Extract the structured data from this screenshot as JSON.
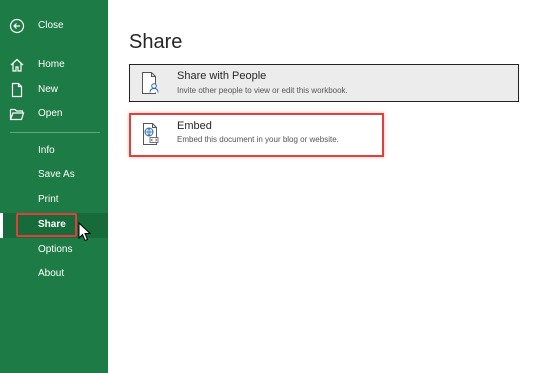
{
  "sidebar": {
    "close_label": "Close",
    "home_label": "Home",
    "new_label": "New",
    "open_label": "Open",
    "info_label": "Info",
    "save_as_label": "Save As",
    "print_label": "Print",
    "share_label": "Share",
    "options_label": "Options",
    "about_label": "About"
  },
  "main": {
    "title": "Share",
    "options": [
      {
        "title": "Share with People",
        "description": "Invite other people to view or edit this workbook.",
        "icon": "share-people-icon"
      },
      {
        "title": "Embed",
        "description": "Embed this document in your blog or website.",
        "icon": "embed-icon"
      }
    ]
  },
  "colors": {
    "sidebar_green": "#1d7b45",
    "highlight_red": "#e0403d"
  }
}
